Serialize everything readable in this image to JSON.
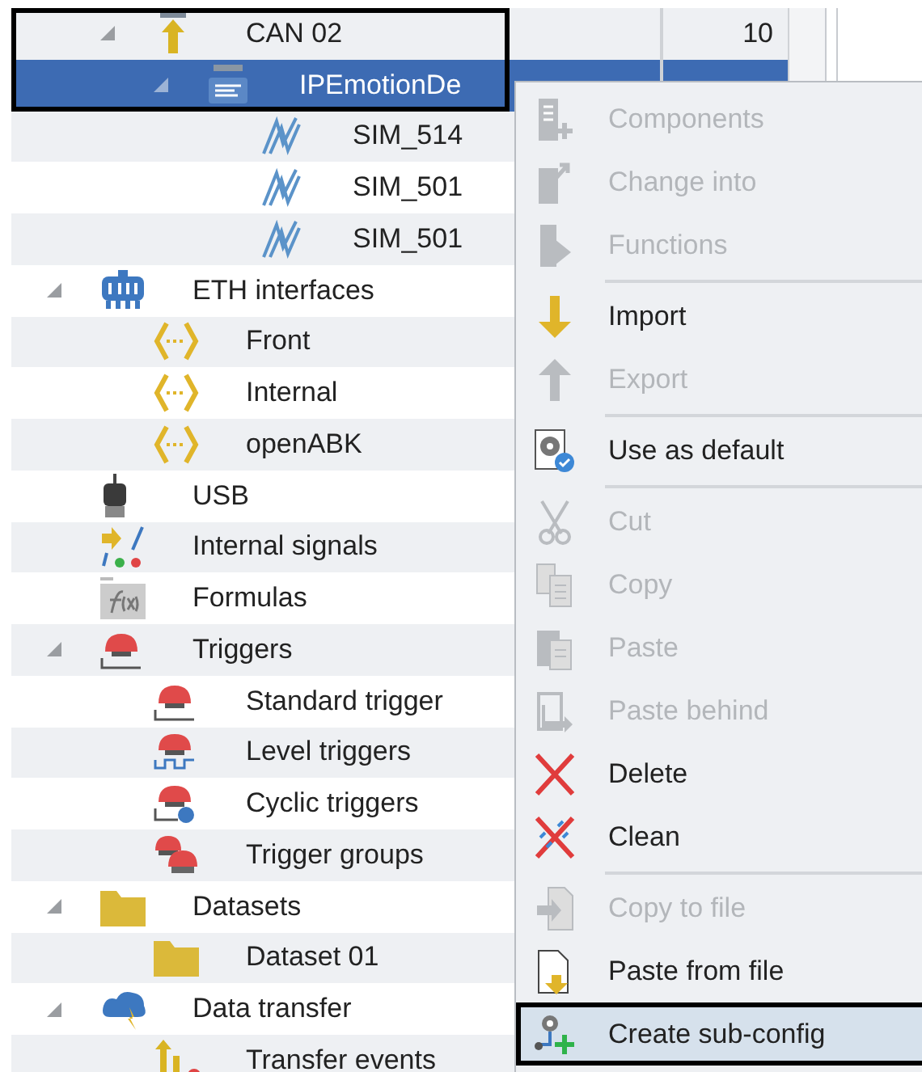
{
  "tree": {
    "items": [
      {
        "children": [
          {
            "label": "CAN 02",
            "kind": "can",
            "value": "10",
            "expanded": true,
            "selected": false,
            "framed": true,
            "children": [
              {
                "label": "IPEmotionDe",
                "kind": "dbc",
                "expanded": true,
                "selected": true,
                "framed": true,
                "children": [
                  {
                    "label": "SIM_514",
                    "kind": "signal",
                    "selected": false,
                    "framed": false
                  },
                  {
                    "label": "SIM_501",
                    "kind": "signal",
                    "selected": false,
                    "framed": false
                  },
                  {
                    "label": "SIM_501",
                    "kind": "signal",
                    "selected": false,
                    "framed": false
                  }
                ]
              }
            ]
          }
        ]
      },
      {
        "label": "ETH interfaces",
        "kind": "eth",
        "expanded": true,
        "selected": false,
        "framed": false,
        "children": [
          {
            "label": "Front",
            "kind": "port",
            "selected": false,
            "framed": false
          },
          {
            "label": "Internal",
            "kind": "port",
            "selected": false,
            "framed": false
          },
          {
            "label": "openABK",
            "kind": "port",
            "selected": false,
            "framed": false
          }
        ]
      },
      {
        "label": "USB",
        "kind": "usb",
        "selected": false,
        "framed": false
      },
      {
        "label": "Internal signals",
        "kind": "internal-signals",
        "selected": false,
        "framed": false
      },
      {
        "label": "Formulas",
        "kind": "formula",
        "selected": false,
        "framed": false
      },
      {
        "label": "Triggers",
        "kind": "trigger",
        "expanded": true,
        "selected": false,
        "framed": false,
        "children": [
          {
            "label": "Standard trigger",
            "kind": "trigger",
            "selected": false,
            "framed": false
          },
          {
            "label": "Level triggers",
            "kind": "level-trigger",
            "selected": false,
            "framed": false
          },
          {
            "label": "Cyclic triggers",
            "kind": "cyclic-trigger",
            "selected": false,
            "framed": false
          },
          {
            "label": "Trigger groups",
            "kind": "trigger-group",
            "selected": false,
            "framed": false
          }
        ]
      },
      {
        "label": "Datasets",
        "kind": "folder",
        "expanded": true,
        "selected": false,
        "framed": false,
        "children": [
          {
            "label": "Dataset 01",
            "kind": "folder",
            "selected": false,
            "framed": false
          }
        ]
      },
      {
        "label": "Data transfer",
        "kind": "cloud",
        "expanded": true,
        "selected": false,
        "framed": false,
        "children": [
          {
            "label": "Transfer events",
            "kind": "transfer",
            "selected": false,
            "framed": false
          }
        ]
      }
    ]
  },
  "context_menu": {
    "items": [
      {
        "kind": "item",
        "label": "Components",
        "disabled": true,
        "highlighted": false
      },
      {
        "kind": "item",
        "label": "Change into",
        "disabled": true,
        "highlighted": false
      },
      {
        "kind": "item",
        "label": "Functions",
        "disabled": true,
        "highlighted": false
      },
      {
        "kind": "separator"
      },
      {
        "kind": "item",
        "label": "Import",
        "disabled": false,
        "highlighted": false
      },
      {
        "kind": "item",
        "label": "Export",
        "disabled": true,
        "highlighted": false
      },
      {
        "kind": "separator"
      },
      {
        "kind": "item",
        "label": "Use as default",
        "disabled": false,
        "highlighted": false
      },
      {
        "kind": "separator"
      },
      {
        "kind": "item",
        "label": "Cut",
        "disabled": true,
        "highlighted": false
      },
      {
        "kind": "item",
        "label": "Copy",
        "disabled": true,
        "highlighted": false
      },
      {
        "kind": "item",
        "label": "Paste",
        "disabled": true,
        "highlighted": false
      },
      {
        "kind": "item",
        "label": "Paste behind",
        "disabled": true,
        "highlighted": false
      },
      {
        "kind": "item",
        "label": "Delete",
        "disabled": false,
        "highlighted": false
      },
      {
        "kind": "item",
        "label": "Clean",
        "disabled": false,
        "highlighted": false
      },
      {
        "kind": "separator"
      },
      {
        "kind": "item",
        "label": "Copy to file",
        "disabled": true,
        "highlighted": false
      },
      {
        "kind": "item",
        "label": "Paste from file",
        "disabled": false,
        "highlighted": false
      },
      {
        "kind": "item",
        "label": "Create sub-config",
        "disabled": false,
        "highlighted": true
      }
    ]
  }
}
